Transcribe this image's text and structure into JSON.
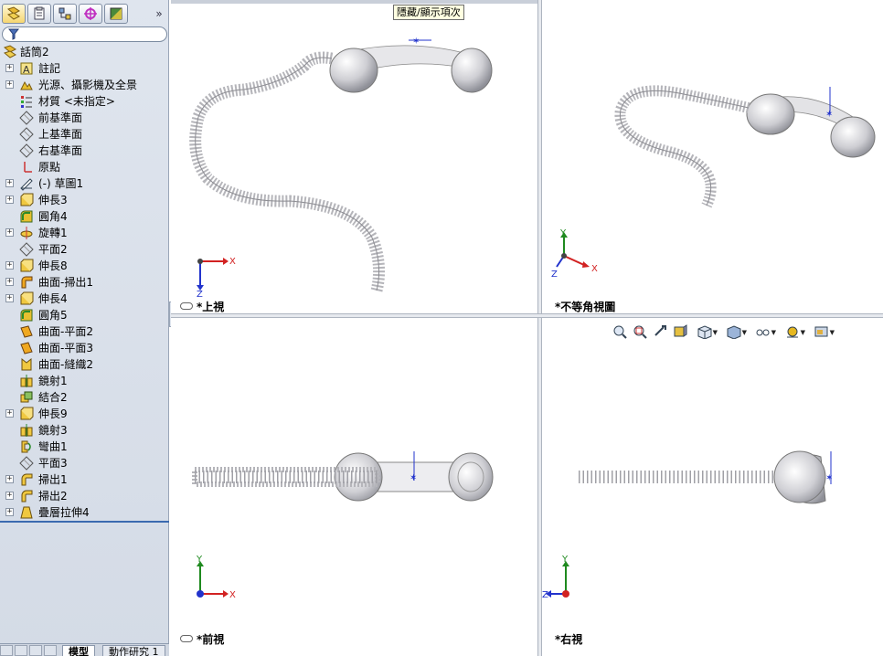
{
  "tooltip": "隱藏/顯示項次",
  "feature_tree": {
    "root": "話筒2",
    "items": [
      {
        "label": "註記",
        "icon": "annotation-icon",
        "expandable": true
      },
      {
        "label": "光源、攝影機及全景",
        "icon": "lights-cameras-scene-icon",
        "expandable": true
      },
      {
        "label": "材質 <未指定>",
        "icon": "material-icon",
        "expandable": false
      },
      {
        "label": "前基準面",
        "icon": "plane-icon",
        "expandable": false
      },
      {
        "label": "上基準面",
        "icon": "plane-icon",
        "expandable": false
      },
      {
        "label": "右基準面",
        "icon": "plane-icon",
        "expandable": false
      },
      {
        "label": "原點",
        "icon": "origin-icon",
        "expandable": false
      },
      {
        "label": "(-) 草圖1",
        "icon": "sketch-icon",
        "expandable": true
      },
      {
        "label": "伸長3",
        "icon": "extrude-icon",
        "expandable": true
      },
      {
        "label": "圓角4",
        "icon": "fillet-icon",
        "expandable": false
      },
      {
        "label": "旋轉1",
        "icon": "revolve-icon",
        "expandable": true
      },
      {
        "label": "平面2",
        "icon": "plane-icon",
        "expandable": false
      },
      {
        "label": "伸長8",
        "icon": "extrude-icon",
        "expandable": true
      },
      {
        "label": "曲面-掃出1",
        "icon": "surface-sweep-icon",
        "expandable": true
      },
      {
        "label": "伸長4",
        "icon": "extrude-icon",
        "expandable": true
      },
      {
        "label": "圓角5",
        "icon": "fillet-icon",
        "expandable": false
      },
      {
        "label": "曲面-平面2",
        "icon": "surface-planar-icon",
        "expandable": false
      },
      {
        "label": "曲面-平面3",
        "icon": "surface-planar-icon",
        "expandable": false
      },
      {
        "label": "曲面-縫織2",
        "icon": "surface-knit-icon",
        "expandable": false
      },
      {
        "label": "鏡射1",
        "icon": "mirror-icon",
        "expandable": false
      },
      {
        "label": "結合2",
        "icon": "combine-icon",
        "expandable": false
      },
      {
        "label": "伸長9",
        "icon": "extrude-icon",
        "expandable": true
      },
      {
        "label": "鏡射3",
        "icon": "mirror-icon",
        "expandable": false
      },
      {
        "label": "彎曲1",
        "icon": "flex-icon",
        "expandable": false
      },
      {
        "label": "平面3",
        "icon": "plane-icon",
        "expandable": false
      },
      {
        "label": "掃出1",
        "icon": "sweep-icon",
        "expandable": true
      },
      {
        "label": "掃出2",
        "icon": "sweep-icon",
        "expandable": true
      },
      {
        "label": "疊層拉伸4",
        "icon": "loft-icon",
        "expandable": true
      }
    ]
  },
  "bottom_tabs": [
    "模型",
    "動作研究 1"
  ],
  "viewports": {
    "top": {
      "label": "*上視",
      "axes": [
        "X",
        "Z"
      ]
    },
    "isometric": {
      "label": "*不等角視圖",
      "axes": [
        "Y",
        "Z",
        "X"
      ]
    },
    "front": {
      "label": "*前視",
      "axes": [
        "Y",
        "X"
      ]
    },
    "right": {
      "label": "*右視",
      "axes": [
        "Y",
        "Z"
      ]
    }
  },
  "heads_up_toolbar": [
    "zoom-to-fit-icon",
    "zoom-to-area-icon",
    "previous-view-icon",
    "section-view-icon",
    "view-orientation-icon",
    "display-style-icon",
    "hide-show-items-icon",
    "edit-appearance-icon",
    "apply-scene-icon"
  ],
  "colors": {
    "x_axis": "#d22222",
    "y_axis": "#1f8a1f",
    "z_axis": "#2233cc",
    "tree_selection": "#3b6ab0",
    "model": "#c8c8cc"
  }
}
